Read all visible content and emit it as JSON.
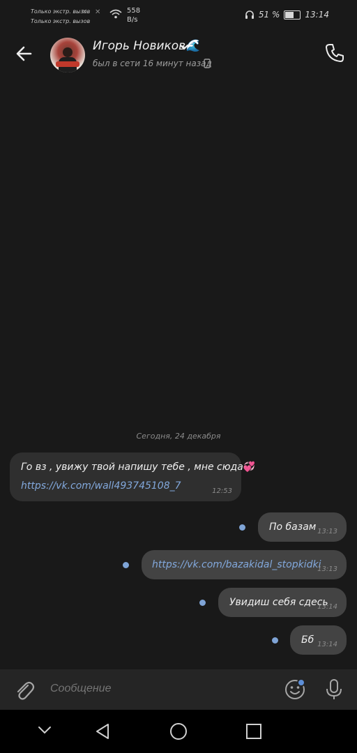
{
  "statusbar": {
    "carrier_line1": "Только экстр. вызов",
    "carrier_line2": "Только экстр. вызов",
    "speed_value": "558",
    "speed_unit": "B/s",
    "battery": "51 %",
    "battery_level": 0.51,
    "time": "13:14"
  },
  "header": {
    "name": "Игорь Новиков🌊",
    "status": "был в сети 16 минут назад"
  },
  "chat": {
    "date_separator": "Сегодня, 24 декабря",
    "messages": [
      {
        "direction": "in",
        "text": "Го вз , увижу твой напишу тебе , мне сюда",
        "emoji": "💞",
        "link": "https://vk.com/wall493745108_7",
        "time": "12:53"
      },
      {
        "direction": "out",
        "text": "По базам",
        "time": "13:13"
      },
      {
        "direction": "out",
        "link": "https://vk.com/bazakidal_stopkidki",
        "time": "13:13"
      },
      {
        "direction": "out",
        "text": "Увидиш себя сдесь",
        "time": "13:14"
      },
      {
        "direction": "out",
        "text": "Бб",
        "time": "13:14"
      }
    ]
  },
  "composer": {
    "placeholder": "Сообщение"
  },
  "icons": {
    "accent": "#7fa4d6",
    "link_color": "#82a8dc"
  }
}
